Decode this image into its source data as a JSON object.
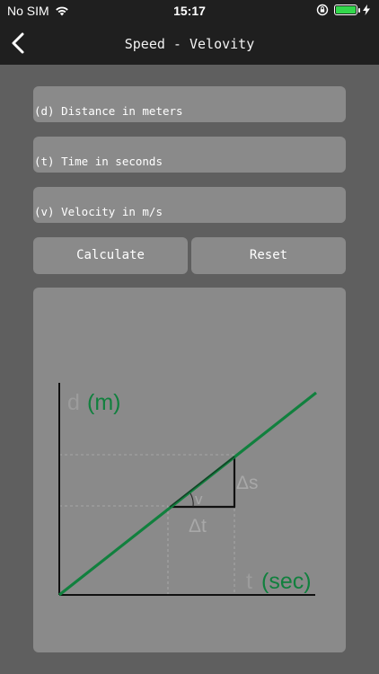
{
  "status_bar": {
    "carrier": "No SIM",
    "time": "15:17"
  },
  "nav": {
    "title": "Speed - Velovity"
  },
  "fields": {
    "distance_placeholder": "(d) Distance in meters",
    "time_placeholder": "(t) Time in seconds",
    "velocity_placeholder": "(v) Velocity in m/s",
    "distance_value": "",
    "time_value": "",
    "velocity_value": ""
  },
  "buttons": {
    "calculate": "Calculate",
    "reset": "Reset"
  },
  "diagram": {
    "y_label_var": "d",
    "y_label_unit": "(m)",
    "x_label_var": "t",
    "x_label_unit": "(sec)",
    "delta_s": "Δs",
    "delta_t": "Δt",
    "angle_label": "v"
  },
  "colors": {
    "accent_green": "#11803e",
    "battery_green": "#32d74b"
  },
  "icons": [
    "wifi-icon",
    "chevron-left-icon",
    "orientation-lock-icon",
    "battery-icon",
    "charging-bolt-icon"
  ]
}
